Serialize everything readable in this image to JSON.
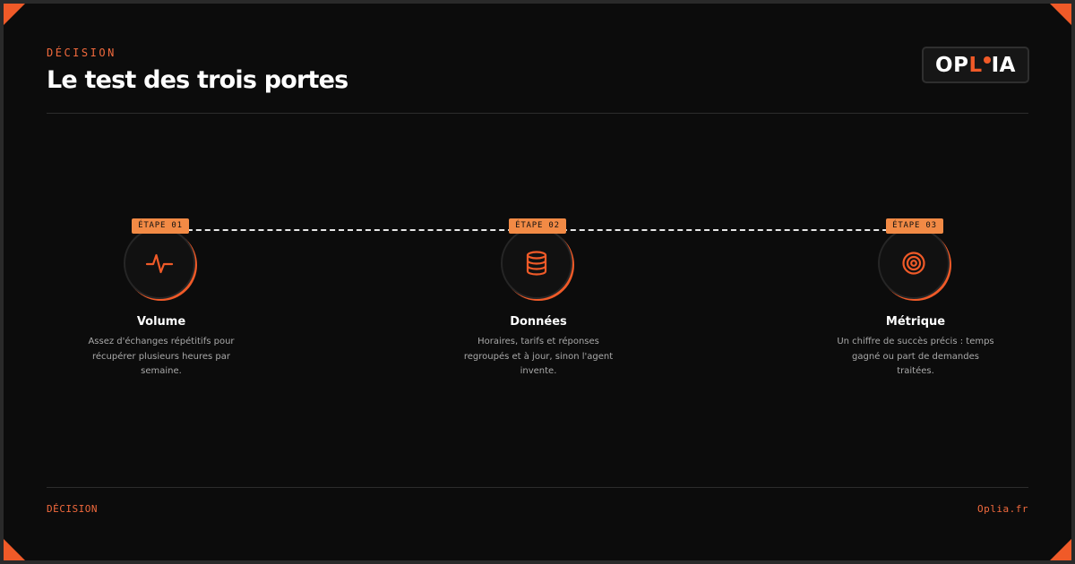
{
  "header": {
    "eyebrow": "DÉCISION",
    "title": "Le test des trois portes",
    "logo": {
      "part1": "OP",
      "part2": "L",
      "part3": "IA"
    }
  },
  "steps": [
    {
      "badge": "ÉTAPE 01",
      "icon": "pulse-icon",
      "title": "Volume",
      "desc": "Assez d'échanges répétitifs pour récupérer plusieurs heures par semaine."
    },
    {
      "badge": "ÉTAPE 02",
      "icon": "database-icon",
      "title": "Données",
      "desc": "Horaires, tarifs et réponses regroupés et à jour, sinon l'agent invente."
    },
    {
      "badge": "ÉTAPE 03",
      "icon": "target-icon",
      "title": "Métrique",
      "desc": "Un chiffre de succès précis : temps gagné ou part de demandes traitées."
    }
  ],
  "footer": {
    "left": "DÉCISION",
    "right": "Oplia.fr"
  },
  "colors": {
    "accent": "#f05a28",
    "badge": "#f28a45",
    "background": "#0c0c0c"
  }
}
